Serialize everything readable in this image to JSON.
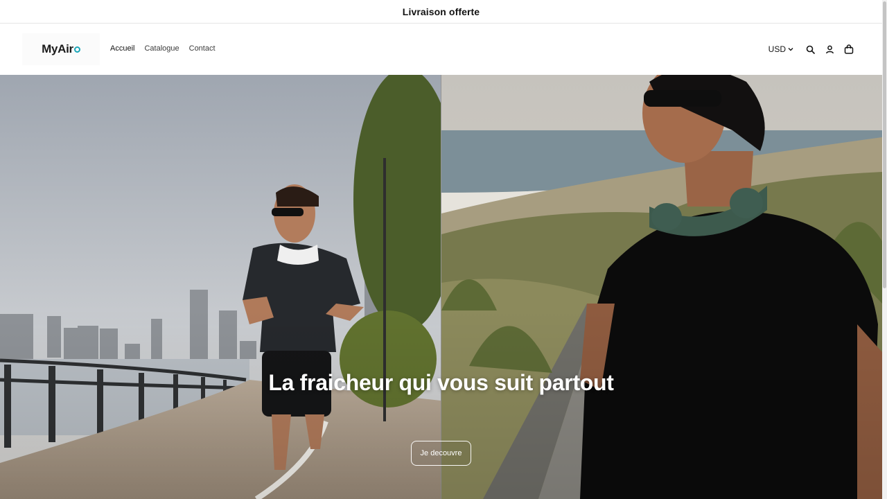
{
  "announcement": {
    "text": "Livraison offerte"
  },
  "header": {
    "logo": {
      "text": "MyAir",
      "accent_color": "#1aa6b8"
    },
    "nav": [
      {
        "label": "Accueil",
        "active": true
      },
      {
        "label": "Catalogue",
        "active": false
      },
      {
        "label": "Contact",
        "active": false
      }
    ],
    "currency": {
      "value": "USD",
      "icon": "chevron-down-icon"
    },
    "icons": [
      "search-icon",
      "account-icon",
      "cart-icon"
    ]
  },
  "hero": {
    "title": "La fraicheur qui vous suit partout",
    "cta_label": "Je decouvre",
    "images": [
      "runner-with-neck-fan-photo",
      "man-beach-neck-fan-photo"
    ]
  },
  "colors": {
    "text": "#121212",
    "background": "#ffffff",
    "accent": "#1aa6b8"
  }
}
